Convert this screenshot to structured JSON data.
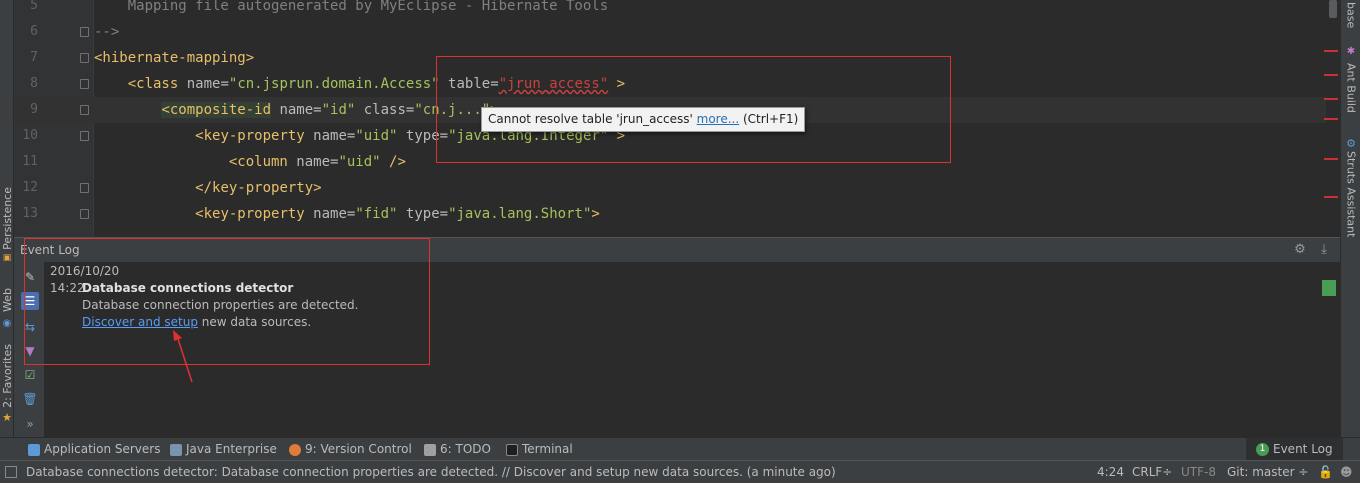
{
  "editor": {
    "lines": [
      {
        "num": "5",
        "code": "    Mapping file autogenerated by MyEclipse - Hibernate Tools"
      },
      {
        "num": "6",
        "code": "-->"
      },
      {
        "num": "7",
        "tag": "<hibernate-mapping>"
      },
      {
        "num": "8",
        "indent": "    ",
        "open": "<class ",
        "a1": "name",
        "eq1": "=",
        "v1": "\"cn.jsprun.domain.Access\"",
        "a2": " table",
        "eq2": "=",
        "v2err": "\"jrun_access\"",
        "close": " >"
      },
      {
        "num": "9",
        "indent": "        ",
        "hl": "<composite-id",
        "a1": " name",
        "eq1": "=",
        "v1": "\"id\"",
        "a2": " class",
        "eq2": "=",
        "v2": "\"cn.j",
        "tail": "...\">"
      },
      {
        "num": "10",
        "indent": "            ",
        "open": "<key-property ",
        "a1": "name",
        "eq1": "=",
        "v1": "\"uid\"",
        "a2": " type",
        "eq2": "=",
        "v2": "\"java.lang.Integer\"",
        "close": " >"
      },
      {
        "num": "11",
        "indent": "                ",
        "open": "<column ",
        "a1": "name",
        "eq1": "=",
        "v1": "\"uid\"",
        "close": " />"
      },
      {
        "num": "12",
        "indent": "            ",
        "tag": "</key-property>"
      },
      {
        "num": "13",
        "indent": "            ",
        "open": "<key-property ",
        "a1": "name",
        "eq1": "=",
        "v1": "\"fid\"",
        "a2": " type",
        "eq2": "=",
        "v2": "\"java.lang.Short\"",
        "close": ">"
      }
    ],
    "tooltip": {
      "text": "Cannot resolve table 'jrun_access'",
      "link": "more...",
      "shortcut": "(Ctrl+F1)"
    }
  },
  "left_tabs": {
    "persistence": "Persistence",
    "web": "Web",
    "favorites": "2: Favorites"
  },
  "right_tabs": {
    "database": "base",
    "ant_build": "Ant Build",
    "struts": "Struts Assistant"
  },
  "event_log": {
    "title": "Event Log",
    "date": "2016/10/20",
    "time": "14:22",
    "entry_title": "Database connections detector",
    "message": "Database connection properties are detected.",
    "link_text": "Discover and setup",
    "link_suffix": " new data sources."
  },
  "bottom_tabs": {
    "app_servers": "Application Servers",
    "java_enterprise": "Java Enterprise",
    "version_control": "9: Version Control",
    "todo": "6: TODO",
    "terminal": "Terminal",
    "event_log": "Event Log",
    "event_log_badge": "1"
  },
  "status": {
    "message": "Database connections detector: Database connection properties are detected. // Discover and setup new data sources. (a minute ago)",
    "position": "4:24",
    "line_sep": "CRLF÷",
    "encoding": "UTF-8",
    "vcs": "Git: master ÷"
  },
  "colors": {
    "error_highlight": "#e03030",
    "link": "#589df6",
    "success": "#499c54"
  }
}
